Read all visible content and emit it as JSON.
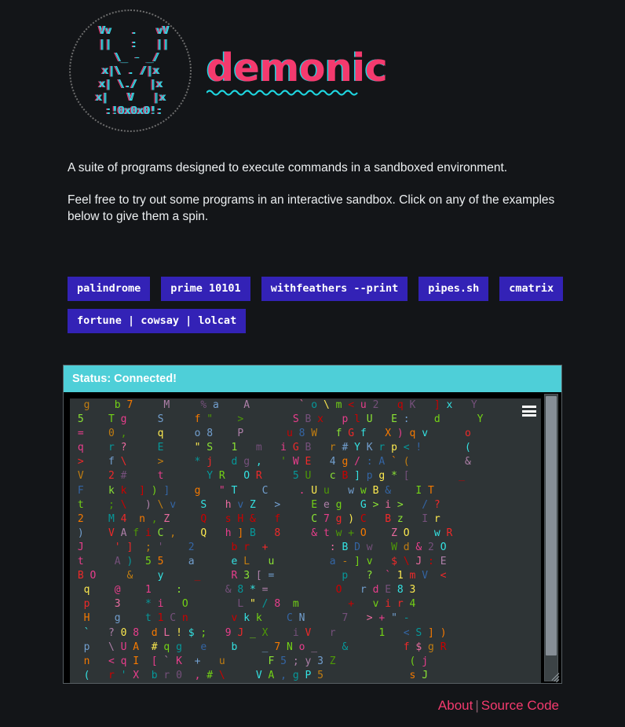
{
  "header": {
    "logo_ascii": " Vv   .   vV\n ||   :   ||\n  \\_ - _/\nx|\\ . /|x\nx| \\./  |x\nx|   V   |x\n :!0x0x0!:",
    "logo_icon": "demon-face-ascii-logo",
    "title": "demonic",
    "underline_icon": "wavy-underline"
  },
  "intro": {
    "paragraph1": "A suite of programs designed to execute commands in a sandboxed environment.",
    "paragraph2": "Feel free to try out some programs in an interactive sandbox. Click on any of the examples below to give them a spin."
  },
  "examples": {
    "buttons": [
      {
        "label": "palindrome"
      },
      {
        "label": "prime 10101"
      },
      {
        "label": "withfeathers --print"
      },
      {
        "label": "pipes.sh"
      },
      {
        "label": "cmatrix"
      },
      {
        "label": "fortune | cowsay | lolcat"
      }
    ]
  },
  "terminal": {
    "status": "Status: Connected!",
    "menu_icon": "hamburger-menu-icon",
    "scrollbar_icon": "vertical-scrollbar",
    "resize_icon": "resize-grip-icon",
    "lines": [
      "  g    b 7     M     % a    A        ` o \\ m < u 2   q K   ] x   Y",
      " 5    T g     S     f \"    >        S B x   p l U   E :    d      Y",
      " =    0 ,     q     o 8    P       u 8 W   f G f   X ) q v      o",
      " q    r ?     E     \" S   1   m   i G B   r # Y K r p < !       (",
      " >    f \\     >     * j   d g ,   ' W E   4 g / : A ` (         &",
      " V    2 #     t       Y R   O R     5 U   c B ] p g * [        _",
      " F    k k  ] ) ]    g   \" T    C     . U u   w w B &    I T",
      " t    ; \\   ) \\ v    S   h v Z   >     E e g   G > i >   / ?",
      " 2    M 4  n , Z     Q   s H &   f     C 7 g ) C   B z   I r",
      " )    V A f i C ,    Q   h ] B   8     & t w + O    Z O    w R",
      " J     ' ]  ; '    2      b r  +          : B D w   W d & 2 O",
      " t     A )  5 5    a      e L   u         a - ] v   $ \\ J : E",
      " B O     &    y     _     R 3 [ =           p   ?  ` 1 m V  <",
      "  q    @    1    :       & 8 * =           O   r d E 8 3",
      "  p    3    * i   O        L \" / 8  m        +   v i r 4",
      "  H    g    t 1 C n       v k k    C N      7   > + \" -",
      "  `   ? 0 8  d L ! $ ;   9 J _ X    i V   r       1   < S ] )",
      "  p   \\ U A  # q g   e    b    _ 7 N o _    &         f $ g R",
      "  n   < q I  [ ` K  +   u       F 5 ; y 3 Z            ( j",
      "  (   r ' X  b r 0  , # \\     V A , g P 5              s J"
    ],
    "palette": [
      "#8ae234",
      "#ef2929",
      "#fce94f",
      "#729fcf",
      "#ad7fa8",
      "#34e2e2",
      "#e96b9f",
      "#f57900",
      "#73d216",
      "#c17d11",
      "#4e9a06",
      "#75507b",
      "#cc0000",
      "#06989a",
      "#3465a4",
      "#e83e8c"
    ]
  },
  "footer": {
    "about": "About",
    "separator": "|",
    "source_code": "Source Code"
  }
}
